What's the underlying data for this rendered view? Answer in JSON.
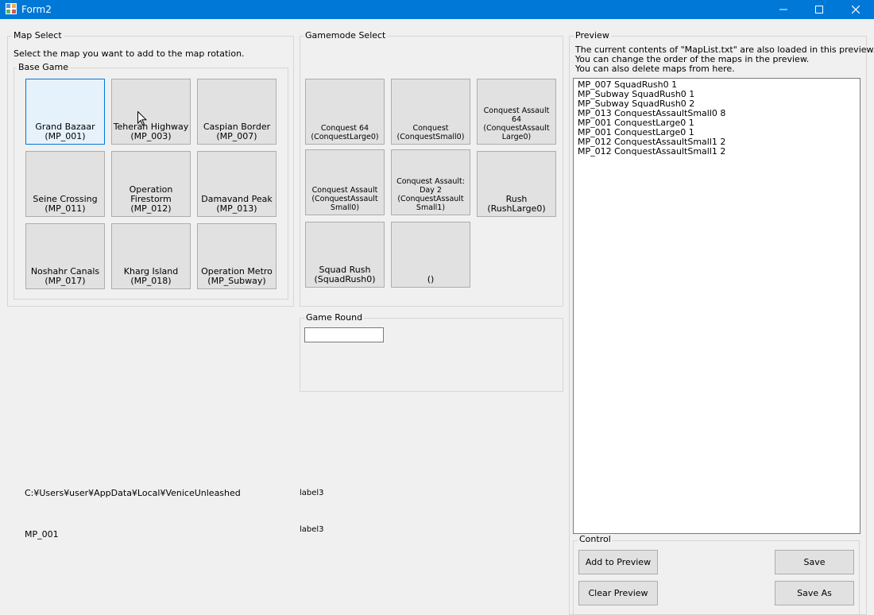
{
  "window": {
    "title": "Form2"
  },
  "map_select": {
    "label": "Map Select",
    "instruction": "Select the map you want to add to the map rotation.",
    "base_game_label": "Base Game",
    "maps": [
      {
        "name": "Grand Bazaar",
        "code": "(MP_001)"
      },
      {
        "name": "Teheran Highway",
        "code": "(MP_003)"
      },
      {
        "name": "Caspian Border",
        "code": "(MP_007)"
      },
      {
        "name": "Seine Crossing",
        "code": "(MP_011)"
      },
      {
        "name": "Operation\nFirestorm",
        "code": "(MP_012)"
      },
      {
        "name": "Damavand Peak",
        "code": "(MP_013)"
      },
      {
        "name": "Noshahr Canals",
        "code": "(MP_017)"
      },
      {
        "name": "Kharg Island",
        "code": "(MP_018)"
      },
      {
        "name": "Operation Metro",
        "code": "(MP_Subway)"
      }
    ]
  },
  "gamemode_select": {
    "label": "Gamemode Select",
    "modes": [
      {
        "text": "Conquest 64\n(ConquestLarge0)"
      },
      {
        "text": "Conquest\n(ConquestSmall0)"
      },
      {
        "text": "Conquest Assault\n64\n(ConquestAssault\nLarge0)"
      },
      {
        "text": "Conquest Assault\n(ConquestAssault\nSmall0)"
      },
      {
        "text": "Conquest Assault:\nDay 2\n(ConquestAssault\nSmall1)"
      },
      {
        "text": "Rush\n(RushLarge0)"
      },
      {
        "text": "Squad Rush\n(SquadRush0)"
      },
      {
        "text": "()"
      }
    ]
  },
  "game_round": {
    "label": "Game Round",
    "value": ""
  },
  "path_label": "C:¥Users¥user¥AppData¥Local¥VeniceUnleashed",
  "selected_map_label": "MP_001",
  "label3_a": "label3",
  "label3_b": "label3",
  "preview": {
    "label": "Preview",
    "description_1": "The current contents of \"MapList.txt\" are also loaded in this preview.",
    "description_2": "You can change the order of the maps in the preview.",
    "description_3": "You can also delete maps from here.",
    "items": [
      "MP_007 SquadRush0 1",
      "MP_Subway SquadRush0 1",
      "MP_Subway SquadRush0 2",
      "MP_013 ConquestAssaultSmall0 8",
      "MP_001 ConquestLarge0 1",
      "MP_001 ConquestLarge0 1",
      "MP_012 ConquestAssaultSmall1 2",
      "MP_012 ConquestAssaultSmall1 2"
    ]
  },
  "control": {
    "label": "Control",
    "add_to_preview": "Add to Preview",
    "clear_preview": "Clear Preview",
    "save": "Save",
    "save_as": "Save As"
  },
  "colors": {
    "titlebar": "#0078d7",
    "selected_tile": "#e5f1fb"
  }
}
